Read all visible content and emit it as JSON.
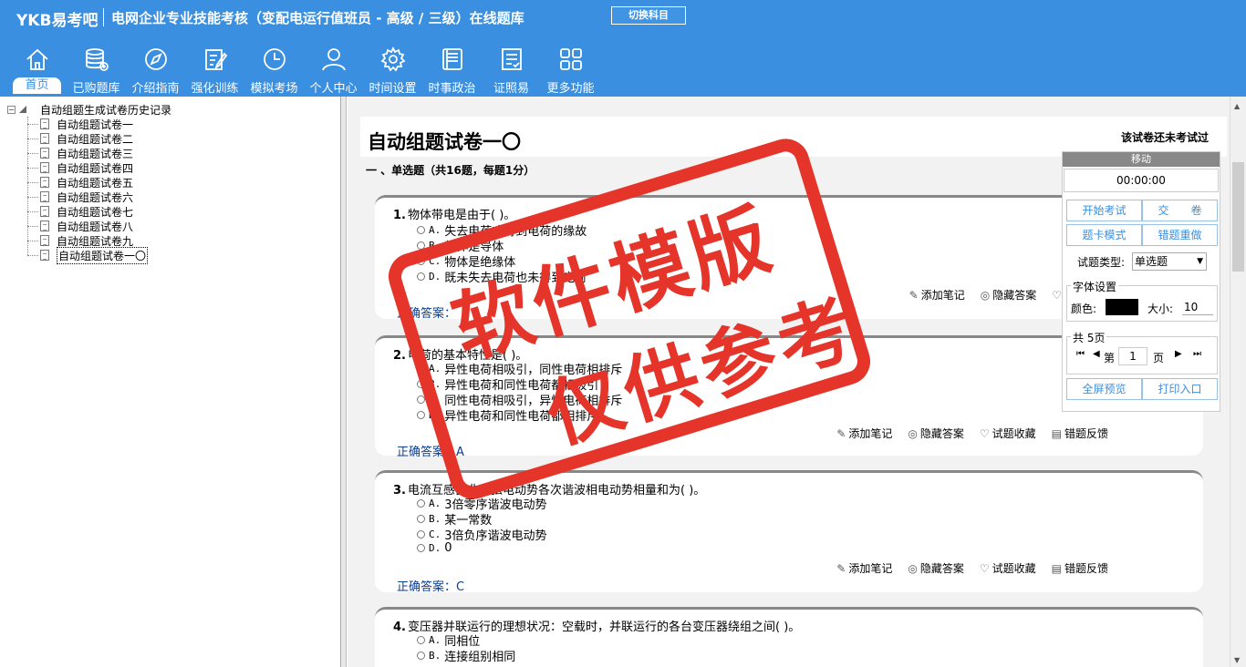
{
  "header": {
    "logo": "YKB易考吧",
    "title": "电网企业专业技能考核（变配电运行值班员 - 高级 / 三级）在线题库",
    "switch_label": "切换科目"
  },
  "nav": [
    {
      "label": "首页",
      "icon": "home-icon"
    },
    {
      "label": "已购题库",
      "icon": "database-icon"
    },
    {
      "label": "介绍指南",
      "icon": "compass-icon"
    },
    {
      "label": "强化训练",
      "icon": "edit-icon"
    },
    {
      "label": "模拟考场",
      "icon": "clock-icon"
    },
    {
      "label": "个人中心",
      "icon": "user-icon"
    },
    {
      "label": "时间设置",
      "icon": "gear-icon"
    },
    {
      "label": "时事政治",
      "icon": "book-icon"
    },
    {
      "label": "证照易",
      "icon": "checklist-icon"
    },
    {
      "label": "更多功能",
      "icon": "grid-icon"
    }
  ],
  "tree": {
    "root": "自动组题生成试卷历史记录",
    "items": [
      "自动组题试卷一",
      "自动组题试卷二",
      "自动组题试卷三",
      "自动组题试卷四",
      "自动组题试卷五",
      "自动组题试卷六",
      "自动组题试卷七",
      "自动组题试卷八",
      "自动组题试卷九",
      "自动组题试卷一〇"
    ],
    "selected_index": 9
  },
  "paper": {
    "title": "自动组题试卷一〇",
    "status": "该试卷还未考试过",
    "section": "一 、单选题（共16题，每题1分）"
  },
  "actions": {
    "note": "添加笔记",
    "hide": "隐藏答案",
    "fav": "试题收藏",
    "feedback": "错题反馈"
  },
  "questions": [
    {
      "num": "1.",
      "text": "物体带电是由于(  )。",
      "options": [
        {
          "letter": "A.",
          "text": "失去电荷或得到电荷的缘故"
        },
        {
          "letter": "B.",
          "text": "物体是导体"
        },
        {
          "letter": "C.",
          "text": "物体是绝缘体"
        },
        {
          "letter": "D.",
          "text": "既未失去电荷也未得到电荷"
        }
      ],
      "answer_label": "正确答案：",
      "answer": ""
    },
    {
      "num": "2.",
      "text": "电荷的基本特性是(  )。",
      "options": [
        {
          "letter": "A.",
          "text": "异性电荷相吸引，同性电荷相排斥"
        },
        {
          "letter": "B.",
          "text": "异性电荷和同性电荷都相吸引"
        },
        {
          "letter": "C.",
          "text": "同性电荷相吸引，异性电荷相排斥"
        },
        {
          "letter": "D.",
          "text": "异性电荷和同性电荷都相排斥"
        }
      ],
      "answer_label": "正确答案：",
      "answer": "A"
    },
    {
      "num": "3.",
      "text": "电流互感器非正弦电动势各次谐波相电动势相量和为(  )。",
      "options": [
        {
          "letter": "A.",
          "text": "3倍零序谐波电动势"
        },
        {
          "letter": "B.",
          "text": "某一常数"
        },
        {
          "letter": "C.",
          "text": "3倍负序谐波电动势"
        },
        {
          "letter": "D.",
          "text": "0"
        }
      ],
      "answer_label": "正确答案：",
      "answer": "C"
    },
    {
      "num": "4.",
      "text": "变压器并联运行的理想状况：空载时，并联运行的各台变压器绕组之间(  )。",
      "options": [
        {
          "letter": "A.",
          "text": "同相位"
        },
        {
          "letter": "B.",
          "text": "连接组别相同"
        }
      ],
      "answer_label": "",
      "answer": ""
    }
  ],
  "control": {
    "move": "移动",
    "timer": "00:00:00",
    "start": "开始考试",
    "submit": "交　　卷",
    "card_mode": "题卡模式",
    "redo": "错题重做",
    "type_label": "试题类型:",
    "type_value": "单选题",
    "font_legend": "字体设置",
    "color_label": "颜色:",
    "size_label": "大小:",
    "size_value": "10",
    "pages_legend": "共 5页",
    "page_prefix": "第",
    "page_value": "1",
    "page_suffix": "页",
    "fullscreen": "全屏预览",
    "print": "打印入口"
  },
  "watermark": {
    "line1": "软件模版",
    "line2": "仅供参考",
    "color": "#e5342a"
  }
}
